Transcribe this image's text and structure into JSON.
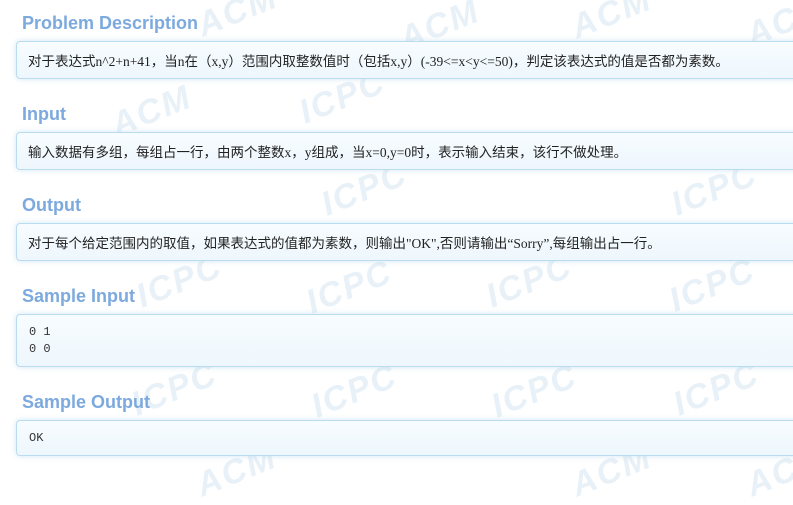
{
  "problem_description": {
    "title": "Problem Description",
    "text": "对于表达式n^2+n+41，当n在（x,y）范围内取整数值时（包括x,y）(-39<=x<y<=50)，判定该表达式的值是否都为素数。"
  },
  "input": {
    "title": "Input",
    "text": "输入数据有多组，每组占一行，由两个整数x，y组成，当x=0,y=0时，表示输入结束，该行不做处理。"
  },
  "output": {
    "title": "Output",
    "text": "对于每个给定范围内的取值，如果表达式的值都为素数，则输出\"OK\",否则请输出“Sorry”,每组输出占一行。"
  },
  "sample_input": {
    "title": "Sample Input",
    "lines": [
      "0 1",
      "0 0"
    ]
  },
  "sample_output": {
    "title": "Sample Output",
    "lines": [
      "OK"
    ]
  },
  "background": {
    "watermark_words": [
      "ACM",
      "ICPC"
    ],
    "watermark_color": "#d6e6f2"
  },
  "colors": {
    "heading": "#7ca9de",
    "panel_border": "#b9dcf0",
    "panel_background": "#eef7fd",
    "text": "#222222"
  }
}
